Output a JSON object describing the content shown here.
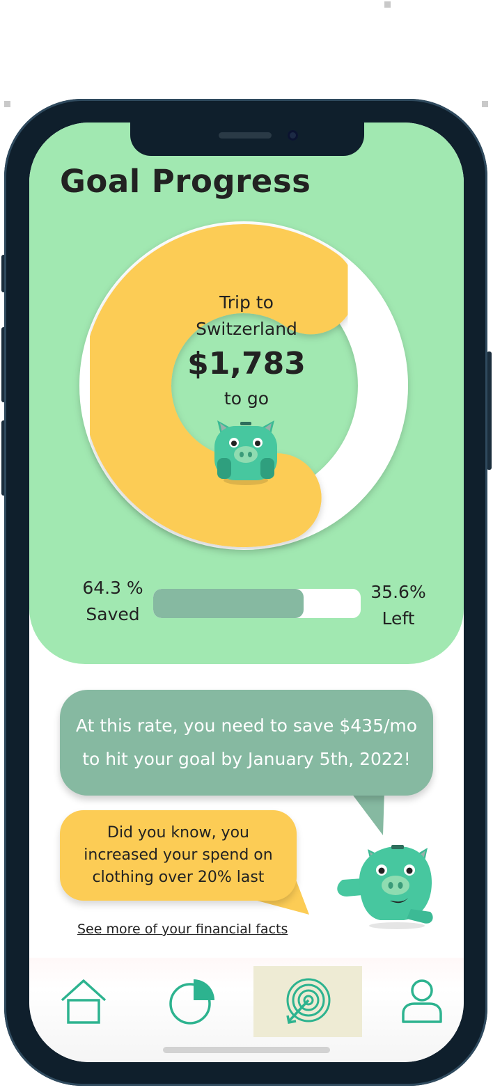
{
  "page": {
    "title": "Goal Progress"
  },
  "goal": {
    "name_line1": "Trip to",
    "name_line2": "Switzerland",
    "amount": "$1,783",
    "suffix": "to go",
    "saved_percent": "64.3 %",
    "saved_label": "Saved",
    "left_percent": "35.6%",
    "left_label": "Left",
    "progress_fraction": 0.724,
    "donut_fraction": 0.643
  },
  "tips": {
    "rate_line1": "At this rate, you need to save $435/mo",
    "rate_line2": "to hit  your goal by January 5th, 2022!",
    "fact_line1": "Did you know, you",
    "fact_line2": "increased your spend on",
    "fact_line3": "clothing over 20% last",
    "facts_link": "See more of your financial facts"
  },
  "nav": {
    "items": [
      {
        "icon": "home-icon"
      },
      {
        "icon": "pie-chart-icon"
      },
      {
        "icon": "target-icon",
        "active": true
      },
      {
        "icon": "profile-icon"
      }
    ]
  },
  "colors": {
    "card_green": "#a1e8b1",
    "donut_yellow": "#fccc55",
    "accent_teal": "#2db38f",
    "muted_green": "#86b9a1",
    "phone_frame": "#0f1f2c"
  }
}
